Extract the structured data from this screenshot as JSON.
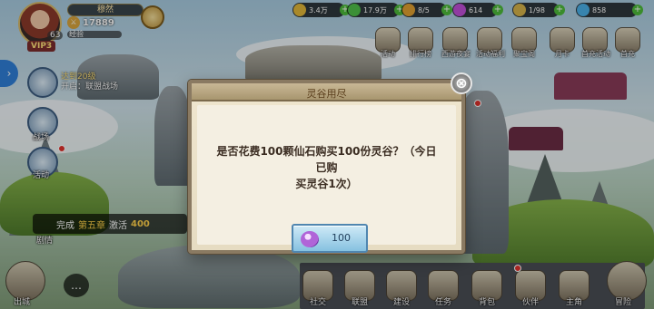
{
  "player": {
    "name": "穆然",
    "power": "17889",
    "level": "63",
    "vip": "VIP3",
    "exp_label": "经验"
  },
  "resources": [
    {
      "name": "gold",
      "value": "3.4万",
      "color": "#e2b739"
    },
    {
      "name": "jade",
      "value": "17.9万",
      "color": "#4fc04a"
    },
    {
      "name": "stamina",
      "value": "8/5",
      "color": "#e0a030"
    },
    {
      "name": "gem",
      "value": "614",
      "color": "#c04fd8"
    },
    {
      "name": "grain",
      "value": "1/98",
      "color": "#d6b34a"
    },
    {
      "name": "diamond",
      "value": "858",
      "color": "#4ab0e8"
    }
  ],
  "top_icons": [
    "活动",
    "排行榜",
    "西游夜宴",
    "活动福利",
    "聚宝阁",
    "月卡",
    "首充活动",
    "首充"
  ],
  "side": {
    "task_title": "达到20级",
    "task_sub": "开启：联盟战场",
    "battle_label": "战场",
    "event_label": "活动"
  },
  "quest": {
    "action": "完成",
    "target": "第五章",
    "reward_word": "激活",
    "reward": "400",
    "label": "剧情"
  },
  "bottom": [
    "出城",
    "社交",
    "联盟",
    "建设",
    "任务",
    "背包",
    "伙伴",
    "主角",
    "冒险"
  ],
  "dialog": {
    "title": "灵谷用尽",
    "message_line1": "是否花费100颗仙石购买100份灵谷？（今日已购",
    "message_line2": "买灵谷1次）",
    "buy_cost": "100"
  }
}
